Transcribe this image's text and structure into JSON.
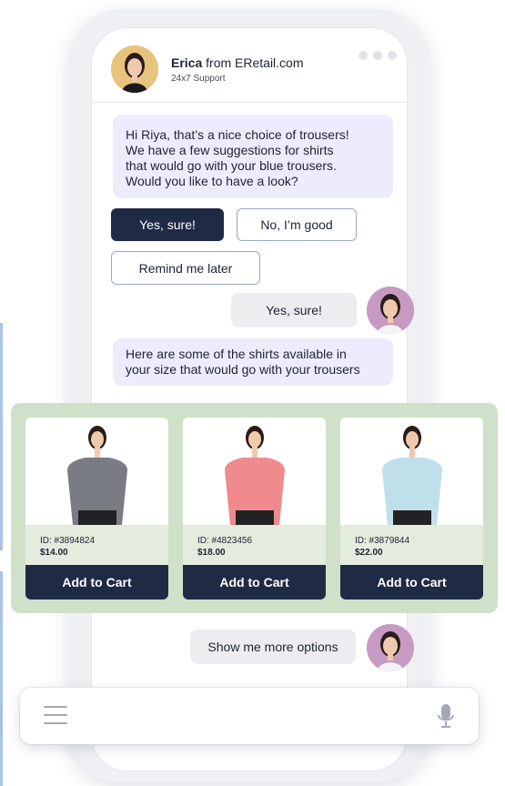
{
  "header": {
    "agent_name": "Erica",
    "agent_from": "from ERetail.com",
    "subtitle": "24x7 Support"
  },
  "messages": {
    "bot_1_lines": [
      "Hi Riya, that’s a nice choice of trousers!",
      "We have a few suggestions for shirts",
      "that would go with your blue trousers.",
      "Would you like to have a look?"
    ],
    "quick_replies": [
      "Yes, sure!",
      "No, I’m good",
      "Remind me later"
    ],
    "user_1": "Yes, sure!",
    "bot_2_lines": [
      "Here are some of the shirts available in",
      "your size that would go with your trousers"
    ],
    "user_2": "Show me more options"
  },
  "products": [
    {
      "id": "ID: #3894824",
      "price": "$14.00",
      "color": "#7a7c84",
      "button": "Add to Cart"
    },
    {
      "id": "ID: #4823456",
      "price": "$18.00",
      "color": "#f08a8c",
      "button": "Add to Cart"
    },
    {
      "id": "ID: #3879844",
      "price": "$22.00",
      "color": "#bfe0ea",
      "button": "Add to Cart"
    }
  ],
  "icons": {
    "menu": "hamburger-icon",
    "mic": "microphone-icon",
    "more": "more-dots-icon"
  },
  "colors": {
    "accent_dark": "#1f2a44",
    "bot_bubble": "#ececfc",
    "carousel_bg": "#cfe1c8",
    "user_bubble": "#ededef"
  }
}
